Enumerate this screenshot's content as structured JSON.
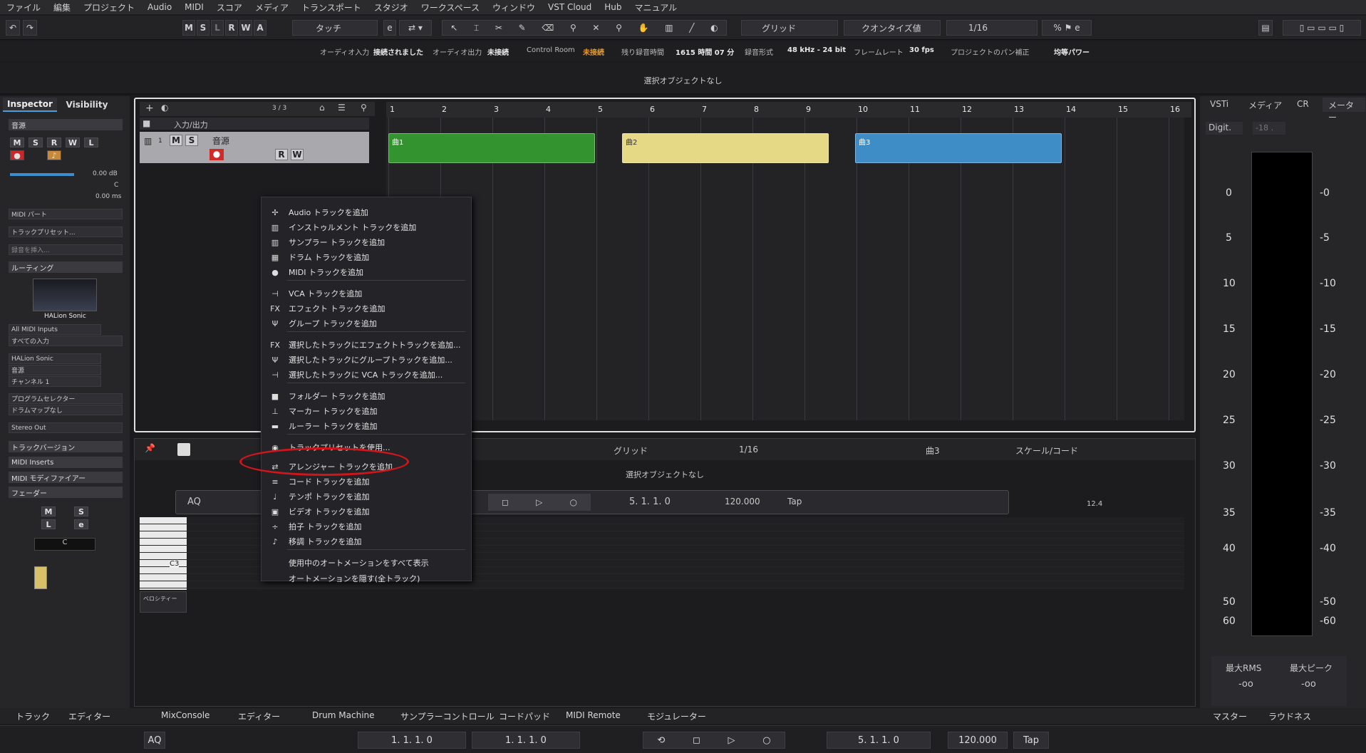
{
  "menu": [
    "ファイル",
    "編集",
    "プロジェクト",
    "Audio",
    "MIDI",
    "スコア",
    "メディア",
    "トランスポート",
    "スタジオ",
    "ワークスペース",
    "ウィンドウ",
    "VST Cloud",
    "Hub",
    "マニュアル"
  ],
  "toolbar": {
    "m": "M",
    "s": "S",
    "l": "L",
    "r": "R",
    "w": "W",
    "a": "A",
    "automode": "タッチ",
    "snap": "グリッド",
    "quantize_type": "クオンタイズ値",
    "quantize": "1/16"
  },
  "status": {
    "audio_in_label": "オーディオ入力",
    "audio_in": "接続されました",
    "audio_out_label": "オーディオ出力",
    "audio_out": "未接続",
    "control_room_label": "Control Room",
    "control_room": "未接続",
    "rec_time_label": "残り録音時間",
    "rec_time": "1615 時間 07 分",
    "rec_format_label": "録音形式",
    "rec_format": "48 kHz - 24 bit",
    "framerate_label": "フレームレート",
    "framerate": "30 fps",
    "pan_label": "プロジェクトのパン補正",
    "pan": "均等パワー"
  },
  "info": "選択オブジェクトなし",
  "inspector": {
    "tab1": "Inspector",
    "tab2": "Visibility",
    "section_sound": "音源",
    "vol": "0.00 dB",
    "pan": "C",
    "delay": "0.00 ms",
    "midi_part": "MIDI パート",
    "track_preset": "トラックプリセット...",
    "insert_rec": "録音を挿入...",
    "routing": "ルーティング",
    "instrument": "HALion Sonic",
    "midi_in": "All MIDI Inputs",
    "all_inputs": "すべての入力",
    "out_inst": "HALion Sonic",
    "out_sound": "音源",
    "channel": "チャンネル 1",
    "program": "プログラムセレクター",
    "drummap": "ドラムマップなし",
    "stereo_out": "Stereo Out",
    "track_versions": "トラックバージョン",
    "midi_inserts": "MIDI Inserts",
    "midi_modifiers": "MIDI モディファイアー",
    "fader": "フェーダー",
    "fader_m": "M",
    "fader_s": "S",
    "fader_l": "L",
    "fader_e": "e",
    "fader_c": "C"
  },
  "project": {
    "counter": "3 / 3",
    "folder": "入力/出力",
    "track_num": "1",
    "track_name": "音源",
    "track_m": "M",
    "track_s": "S",
    "track_r": "R",
    "track_w": "W",
    "bars": [
      "1",
      "2",
      "3",
      "4",
      "5",
      "6",
      "7",
      "8",
      "9",
      "10",
      "11",
      "12",
      "13",
      "14",
      "15",
      "16"
    ],
    "parts": [
      {
        "name": "曲1",
        "color": "#33942f"
      },
      {
        "name": "曲2",
        "color": "#e5d985"
      },
      {
        "name": "曲3",
        "color": "#3f8dc6"
      }
    ]
  },
  "context_menu": [
    {
      "icon": "✢",
      "label": "Audio トラックを追加"
    },
    {
      "icon": "▥",
      "label": "インストゥルメント トラックを追加"
    },
    {
      "icon": "▥",
      "label": "サンプラー トラックを追加"
    },
    {
      "icon": "▦",
      "label": "ドラム トラックを追加"
    },
    {
      "icon": "●",
      "label": "MIDI トラックを追加"
    },
    {
      "icon": "⊣",
      "label": "VCA トラックを追加"
    },
    {
      "icon": "FX",
      "label": "エフェクト トラックを追加"
    },
    {
      "icon": "Ψ",
      "label": "グループ トラックを追加"
    },
    {
      "icon": "FX",
      "label": "選択したトラックにエフェクトトラックを追加..."
    },
    {
      "icon": "Ψ",
      "label": "選択したトラックにグループトラックを追加..."
    },
    {
      "icon": "⊣",
      "label": "選択したトラックに VCA トラックを追加..."
    },
    {
      "icon": "■",
      "label": "フォルダー トラックを追加"
    },
    {
      "icon": "⊥",
      "label": "マーカー トラックを追加"
    },
    {
      "icon": "▬",
      "label": "ルーラー トラックを追加"
    },
    {
      "icon": "◉",
      "label": "トラックプリセットを使用..."
    },
    {
      "icon": "⇄",
      "label": "アレンジャー トラックを追加"
    },
    {
      "icon": "≡",
      "label": "コード トラックを追加"
    },
    {
      "icon": "♩",
      "label": "テンポ トラックを追加"
    },
    {
      "icon": "▣",
      "label": "ビデオ トラックを追加"
    },
    {
      "icon": "÷",
      "label": "拍子 トラックを追加"
    },
    {
      "icon": "♪",
      "label": "移調 トラックを追加"
    },
    {
      "icon": "",
      "label": "使用中のオートメーションをすべて表示"
    },
    {
      "icon": "",
      "label": "オートメーションを隠す(全トラック)"
    }
  ],
  "editor": {
    "snap": "グリッド",
    "quantize": "1/16",
    "part": "曲3",
    "scale": "スケール/コード",
    "info": "選択オブジェクトなし",
    "aq": "AQ",
    "pos": "5. 1. 1.    0",
    "tempo": "120.000",
    "tap": "Tap",
    "ruler_mark": "12.4",
    "c3": "C3",
    "lane": "ベロシティー"
  },
  "meter": {
    "tab1": "VSTi",
    "tab2": "メディア",
    "tab3": "CR",
    "tab4": "メーター",
    "mode": "Digit.",
    "level": "-18 .",
    "scale": [
      "0",
      "5",
      "10",
      "15",
      "20",
      "25",
      "30",
      "35",
      "40",
      "50",
      "60"
    ],
    "max_rms_label": "最大RMS",
    "max_peak_label": "最大ピーク",
    "max_rms": "-oo",
    "max_peak": "-oo"
  },
  "bottom_tabs": {
    "track": "トラック",
    "editor": "エディター",
    "mixconsole": "MixConsole",
    "editor2": "エディター",
    "drum": "Drum Machine",
    "sampler": "サンプラーコントロール",
    "chordpad": "コードパッド",
    "midiremote": "MIDI Remote",
    "modulator": "モジュレーター",
    "master": "マスター",
    "loudness": "ラウドネス"
  },
  "transport": {
    "aq": "AQ",
    "left": "1.  1.  1.    0",
    "right": "1.  1.  1.    0",
    "pos": "5.  1.  1.    0",
    "tempo": "120.000",
    "tap": "Tap"
  }
}
